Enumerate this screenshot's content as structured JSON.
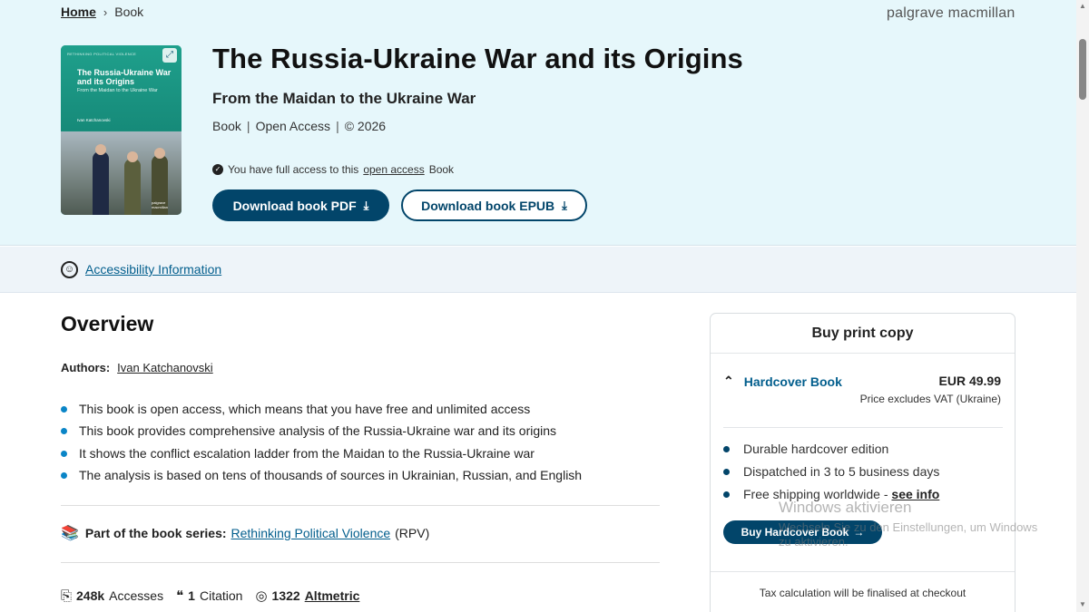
{
  "breadcrumb": {
    "home": "Home",
    "separator": "›",
    "current": "Book"
  },
  "brand": "palgrave macmillan",
  "cover": {
    "series": "RETHINKING POLITICAL VIOLENCE",
    "title": "The Russia-Ukraine War and its Origins",
    "subtitle": "From the Maidan to the Ukraine War",
    "author": "Ivan Katchanovski",
    "publisher": "palgrave macmillan"
  },
  "book": {
    "title": "The Russia-Ukraine War and its Origins",
    "subtitle": "From the Maidan to the Ukraine War",
    "meta": [
      "Book",
      "Open Access",
      "© 2026"
    ],
    "meta_sep": "|",
    "access_prefix": "You have full access to this",
    "access_link": "open access",
    "access_suffix": "Book"
  },
  "buttons": {
    "pdf": "Download book PDF",
    "epub": "Download book EPUB"
  },
  "accessibility": {
    "link": "Accessibility Information"
  },
  "overview": {
    "title": "Overview",
    "authors_label": "Authors:",
    "author": "Ivan Katchanovski",
    "bullets": [
      "This book is open access, which means that you have free and unlimited access",
      "This book provides comprehensive analysis of the Russia-Ukraine war and its origins",
      "It shows the conflict escalation ladder from the Maidan to the Russia-Ukraine war",
      "The analysis is based on tens of thousands of sources in Ukrainian, Russian, and English"
    ],
    "series_label": "Part of the book series:",
    "series_link": "Rethinking Political Violence",
    "series_abbr": "(RPV)",
    "metrics": {
      "accesses_value": "248k",
      "accesses_label": "Accesses",
      "citations_value": "1",
      "citations_label": "Citation",
      "altmetric_value": "1322",
      "altmetric_label": "Altmetric"
    }
  },
  "buy": {
    "header": "Buy print copy",
    "format": "Hardcover Book",
    "price": "EUR 49.99",
    "vat": "Price excludes VAT (Ukraine)",
    "features": [
      "Durable hardcover edition",
      "Dispatched in 3 to 5 business days",
      "Free shipping worldwide -"
    ],
    "see_info": "see info",
    "button": "Buy Hardcover Book",
    "tax": "Tax calculation will be finalised at checkout"
  },
  "watermark": {
    "line1": "Windows aktivieren",
    "line2": "Wechseln Sie zu den Einstellungen, um Windows zu aktivieren."
  },
  "colors": {
    "hero_bg": "#e6f7fb",
    "primary": "#02456a",
    "link": "#025e8d",
    "bullet": "#0a85c7"
  }
}
